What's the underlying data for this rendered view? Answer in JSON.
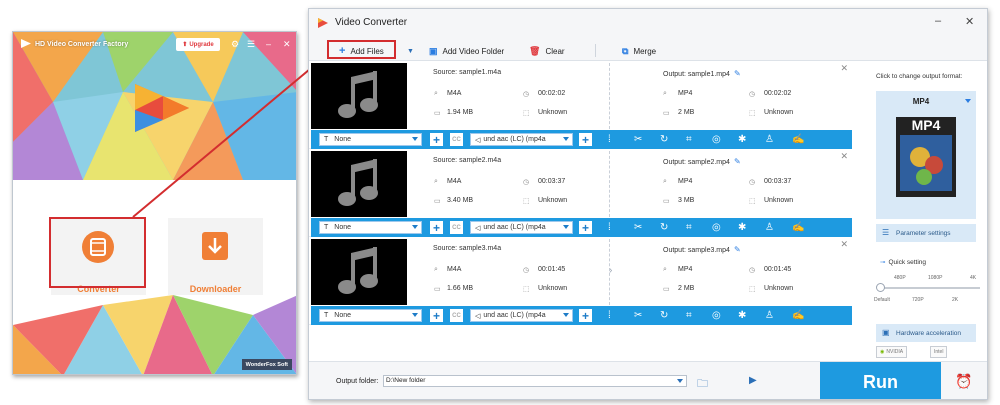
{
  "launcher": {
    "title": "HD Video Converter Factory",
    "upgrade_label": "Upgrade",
    "converter_label": "Converter",
    "downloader_label": "Downloader",
    "brand_badge": "WonderFox Soft"
  },
  "main": {
    "title": "Video Converter",
    "toolbar": {
      "add_files": "Add Files",
      "add_video_folder": "Add Video Folder",
      "clear": "Clear",
      "merge": "Merge"
    },
    "items": [
      {
        "source": "Source: sample1.m4a",
        "src_format": "M4A",
        "src_duration": "00:02:02",
        "src_size": "1.94 MB",
        "src_resolution": "Unknown",
        "output": "Output: sample1.mp4",
        "out_format": "MP4",
        "out_duration": "00:02:02",
        "out_size": "2 MB",
        "out_resolution": "Unknown",
        "subtitle": "None",
        "audio": "und aac (LC) (mp4a"
      },
      {
        "source": "Source: sample2.m4a",
        "src_format": "M4A",
        "src_duration": "00:03:37",
        "src_size": "3.40 MB",
        "src_resolution": "Unknown",
        "output": "Output: sample2.mp4",
        "out_format": "MP4",
        "out_duration": "00:03:37",
        "out_size": "3 MB",
        "out_resolution": "Unknown",
        "subtitle": "None",
        "audio": "und aac (LC) (mp4a"
      },
      {
        "source": "Source: sample3.m4a",
        "src_format": "M4A",
        "src_duration": "00:01:45",
        "src_size": "1.66 MB",
        "src_resolution": "Unknown",
        "output": "Output: sample3.mp4",
        "out_format": "MP4",
        "out_duration": "00:01:45",
        "out_size": "2 MB",
        "out_resolution": "Unknown",
        "subtitle": "None",
        "audio": "und aac (LC) (mp4a"
      }
    ],
    "cc_label": "CC",
    "right_panel": {
      "caption": "Click to change output format:",
      "format": "MP4",
      "format_art_text": "MP4",
      "parameter_settings": "Parameter settings",
      "quick_setting": "Quick setting",
      "ticks_top": [
        "480P",
        "1080P",
        "4K"
      ],
      "ticks_bottom": [
        "Default",
        "720P",
        "2K"
      ],
      "hardware_acceleration": "Hardware acceleration",
      "nvidia": "NVIDIA",
      "intel": "Intel"
    },
    "bottom": {
      "output_folder_label": "Output folder:",
      "output_folder_value": "D:\\New folder",
      "run": "Run"
    }
  },
  "colors": {
    "accent_blue": "#1e9ae0",
    "highlight_red": "#d32d2f",
    "converter_orange": "#f07f36"
  }
}
